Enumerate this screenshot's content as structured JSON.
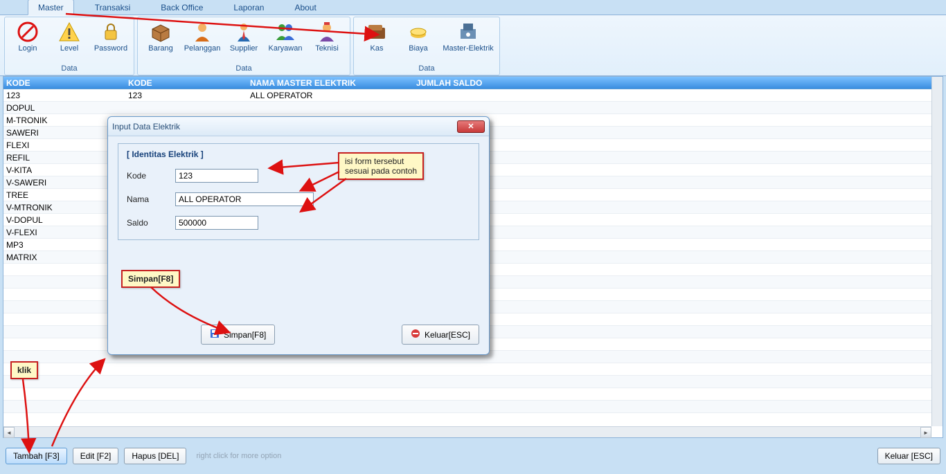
{
  "tabs": [
    "Master",
    "Transaksi",
    "Back Office",
    "Laporan",
    "About"
  ],
  "ribbon": {
    "groups": [
      {
        "label": "Data",
        "items": [
          "Login",
          "Level",
          "Password"
        ]
      },
      {
        "label": "Data",
        "items": [
          "Barang",
          "Pelanggan",
          "Supplier",
          "Karyawan",
          "Teknisi"
        ]
      },
      {
        "label": "Data",
        "items": [
          "Kas",
          "Biaya",
          "Master-Elektrik"
        ]
      }
    ]
  },
  "grid": {
    "headers": [
      "KODE",
      "KODE",
      "NAMA MASTER ELEKTRIK",
      "JUMLAH SALDO"
    ],
    "rows": [
      {
        "c0": "123",
        "c1": "123",
        "c2": "ALL OPERATOR"
      },
      {
        "c0": "DOPUL"
      },
      {
        "c0": "M-TRONIK"
      },
      {
        "c0": "SAWERI"
      },
      {
        "c0": "FLEXI"
      },
      {
        "c0": "REFIL"
      },
      {
        "c0": "V-KITA"
      },
      {
        "c0": "V-SAWERI"
      },
      {
        "c0": "TREE"
      },
      {
        "c0": "V-MTRONIK"
      },
      {
        "c0": "V-DOPUL"
      },
      {
        "c0": "V-FLEXI"
      },
      {
        "c0": "MP3"
      },
      {
        "c0": "MATRIX"
      }
    ]
  },
  "footer": {
    "tambah": "Tambah [F3]",
    "edit": "Edit [F2]",
    "hapus": "Hapus [DEL]",
    "hint": "right click for more option",
    "keluar": "Keluar [ESC]"
  },
  "dialog": {
    "title": "Input Data Elektrik",
    "legend": "[ Identitas Elektrik ]",
    "kode_label": "Kode",
    "nama_label": "Nama",
    "saldo_label": "Saldo",
    "kode_value": "123",
    "nama_value": "ALL OPERATOR",
    "saldo_value": "500000",
    "simpan": "Simpan[F8]",
    "keluar": "Keluar[ESC]"
  },
  "callouts": {
    "c1": "isi form tersebut\nsesuai pada contoh",
    "c2": "Simpan[F8]",
    "c3": "klik"
  },
  "icons": {
    "login": "nologin",
    "level": "warn",
    "password": "lock",
    "barang": "box",
    "pelanggan": "person",
    "supplier": "person2",
    "karyawan": "people",
    "teknisi": "tech",
    "kas": "wallet",
    "biaya": "cash",
    "master": "pos"
  }
}
